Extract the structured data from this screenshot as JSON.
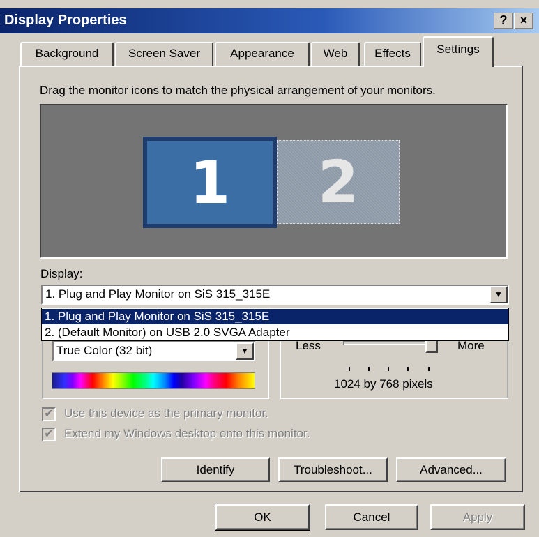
{
  "window": {
    "title": "Display Properties",
    "help_button": "?",
    "close_button": "×"
  },
  "tabs": [
    {
      "label": "Background",
      "active": false
    },
    {
      "label": "Screen Saver",
      "active": false
    },
    {
      "label": "Appearance",
      "active": false
    },
    {
      "label": "Web",
      "active": false
    },
    {
      "label": "Effects",
      "active": false
    },
    {
      "label": "Settings",
      "active": true
    }
  ],
  "settings": {
    "instructions": "Drag the monitor icons to match the physical arrangement of your monitors.",
    "monitors": [
      {
        "number": "1",
        "selected": true
      },
      {
        "number": "2",
        "selected": false
      }
    ],
    "display_label": "Display:",
    "display_selected": "1. Plug and Play Monitor on SiS 315_315E",
    "display_options": [
      "1. Plug and Play Monitor on SiS 315_315E",
      "2. (Default Monitor) on USB 2.0 SVGA Adapter"
    ],
    "color_quality_value": "True Color (32 bit)",
    "resolution": {
      "less_label": "Less",
      "more_label": "More",
      "value_text": "1024 by 768 pixels",
      "slider_position": 1.0
    },
    "primary_monitor_label": "Use this device as the primary monitor.",
    "primary_monitor_checked": true,
    "extend_desktop_label": "Extend my Windows desktop onto this monitor.",
    "extend_desktop_checked": true,
    "identify_button": "Identify",
    "troubleshoot_button": "Troubleshoot...",
    "advanced_button": "Advanced..."
  },
  "footer": {
    "ok_button": "OK",
    "cancel_button": "Cancel",
    "apply_button": "Apply"
  },
  "colors": {
    "dialog_face": "#d4d0c8",
    "title_bar": "#0a246a",
    "selection": "#0a246a",
    "monitor_area": "#747474",
    "monitor_screen": "#3a6ea5"
  }
}
